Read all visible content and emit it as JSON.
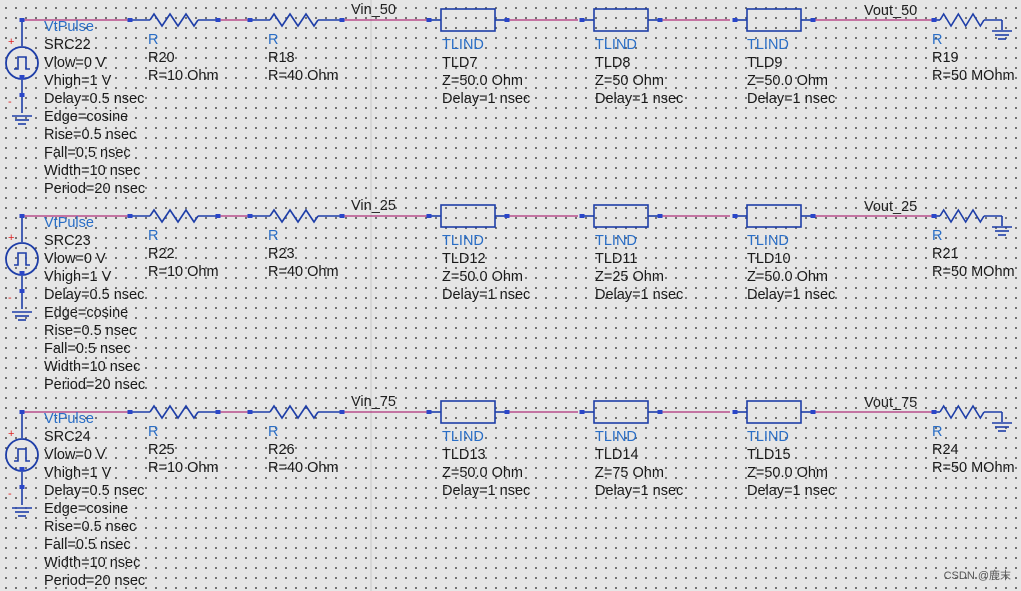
{
  "rows": [
    {
      "source": {
        "type": "VtPulse",
        "name": "SRC22",
        "params": [
          "Vlow=0 V",
          "Vhigh=1 V",
          "Delay=0.5 nsec",
          "Edge=cosine",
          "Rise=0.5 nsec",
          "Fall=0.5 nsec",
          "Width=10 nsec",
          "Period=20 nsec"
        ]
      },
      "resistors": [
        {
          "type": "R",
          "name": "R20",
          "value": "R=10 Ohm"
        },
        {
          "type": "R",
          "name": "R18",
          "value": "R=40 Ohm"
        }
      ],
      "vin_label": "Vin_50",
      "tlines": [
        {
          "type": "TLIND",
          "name": "TLD7",
          "z": "Z=50.0 Ohm",
          "delay": "Delay=1 nsec"
        },
        {
          "type": "TLIND",
          "name": "TLD8",
          "z": "Z=50 Ohm",
          "delay": "Delay=1 nsec"
        },
        {
          "type": "TLIND",
          "name": "TLD9",
          "z": "Z=50.0 Ohm",
          "delay": "Delay=1 nsec"
        }
      ],
      "vout_label": "Vout_50",
      "load": {
        "type": "R",
        "name": "R19",
        "value": "R=50 MOhm"
      }
    },
    {
      "source": {
        "type": "VtPulse",
        "name": "SRC23",
        "params": [
          "Vlow=0 V",
          "Vhigh=1 V",
          "Delay=0.5 nsec",
          "Edge=cosine",
          "Rise=0.5 nsec",
          "Fall=0.5 nsec",
          "Width=10 nsec",
          "Period=20 nsec"
        ]
      },
      "resistors": [
        {
          "type": "R",
          "name": "R22",
          "value": "R=10 Ohm"
        },
        {
          "type": "R",
          "name": "R23",
          "value": "R=40 Ohm"
        }
      ],
      "vin_label": "Vin_25",
      "tlines": [
        {
          "type": "TLIND",
          "name": "TLD12",
          "z": "Z=50.0 Ohm",
          "delay": "Delay=1 nsec"
        },
        {
          "type": "TLIND",
          "name": "TLD11",
          "z": "Z=25 Ohm",
          "delay": "Delay=1 nsec"
        },
        {
          "type": "TLIND",
          "name": "TLD10",
          "z": "Z=50.0 Ohm",
          "delay": "Delay=1 nsec"
        }
      ],
      "vout_label": "Vout_25",
      "load": {
        "type": "R",
        "name": "R21",
        "value": "R=50 MOhm"
      }
    },
    {
      "source": {
        "type": "VtPulse",
        "name": "SRC24",
        "params": [
          "Vlow=0 V",
          "Vhigh=1 V",
          "Delay=0.5 nsec",
          "Edge=cosine",
          "Rise=0.5 nsec",
          "Fall=0.5 nsec",
          "Width=10 nsec",
          "Period=20 nsec"
        ]
      },
      "resistors": [
        {
          "type": "R",
          "name": "R25",
          "value": "R=10 Ohm"
        },
        {
          "type": "R",
          "name": "R26",
          "value": "R=40 Ohm"
        }
      ],
      "vin_label": "Vin_75",
      "tlines": [
        {
          "type": "TLIND",
          "name": "TLD13",
          "z": "Z=50.0 Ohm",
          "delay": "Delay=1 nsec"
        },
        {
          "type": "TLIND",
          "name": "TLD14",
          "z": "Z=75 Ohm",
          "delay": "Delay=1 nsec"
        },
        {
          "type": "TLIND",
          "name": "TLD15",
          "z": "Z=50.0 Ohm",
          "delay": "Delay=1 nsec"
        }
      ],
      "vout_label": "Vout_75",
      "load": {
        "type": "R",
        "name": "R24",
        "value": "R=50 MOhm"
      }
    }
  ],
  "source_symbol": {
    "plus": "+",
    "minus": "-"
  },
  "watermark": "CSDN @鹿末",
  "colors": {
    "wire": "#b0307a",
    "component": "#1e3ea8",
    "type_label": "#2a6ec6",
    "text": "#1a1a1a",
    "background": "#e6e6e6",
    "pin_marker": "#2a46c8"
  }
}
